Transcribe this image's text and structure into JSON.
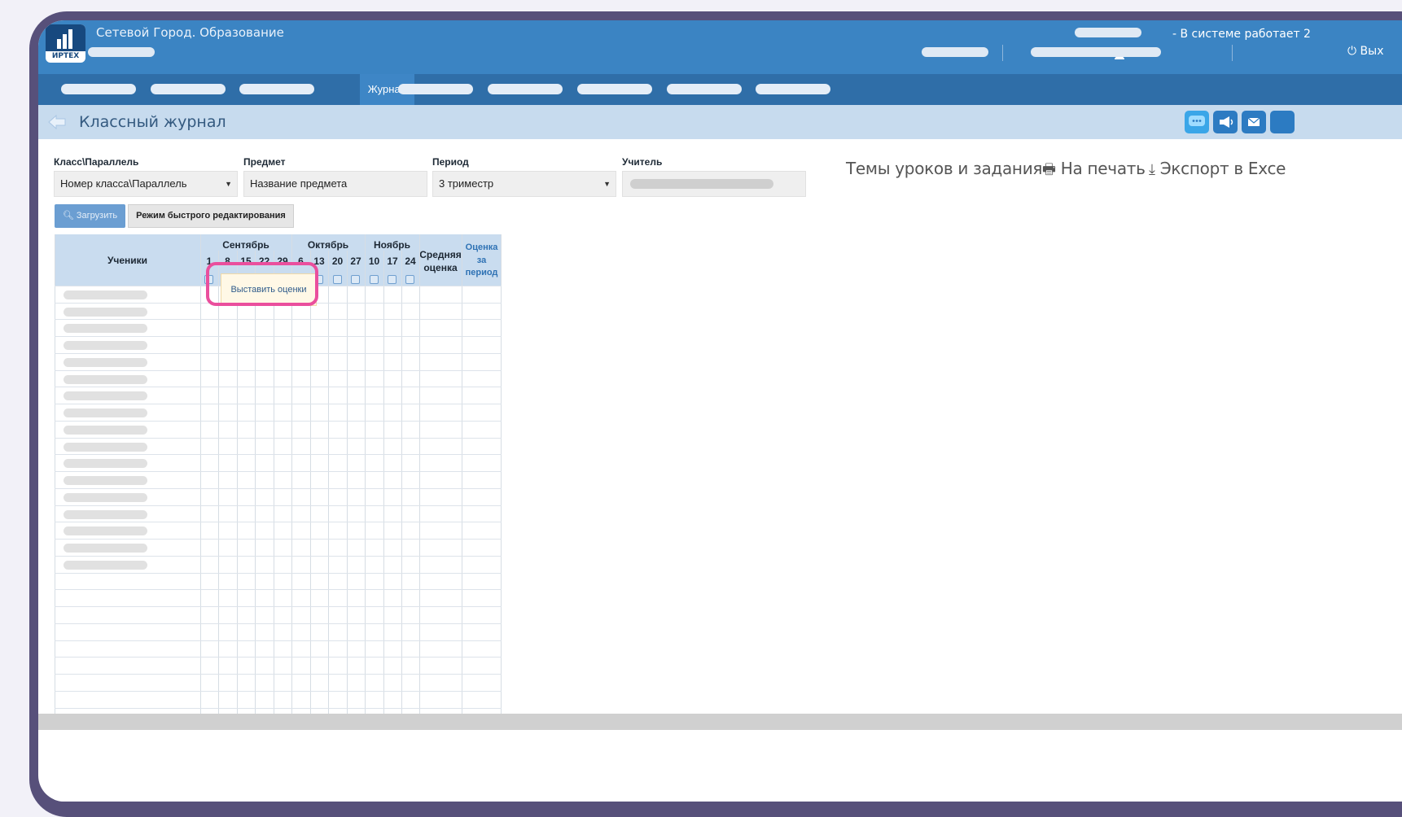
{
  "header": {
    "app_title": "Сетевой Город. Образование",
    "logo_text": "ИРТЕХ",
    "system_status": "- В системе работает 2",
    "logout_label": "Вых"
  },
  "nav": {
    "active_tab": "Журнал"
  },
  "page": {
    "title": "Классный журнал"
  },
  "filters": {
    "class_label": "Класс\\Параллель",
    "class_value": "Номер класса\\Параллель",
    "subject_label": "Предмет",
    "subject_value": "Название предмета",
    "period_label": "Период",
    "period_value": "3 триместр",
    "teacher_label": "Учитель"
  },
  "actions": {
    "topics_link": "Темы уроков и задания",
    "print_link": "На печать",
    "export_link": "Экспорт в Exce",
    "load_button": "Загрузить",
    "fast_edit_button": "Режим быстрого редактирования"
  },
  "journal": {
    "students_header": "Ученики",
    "months": [
      {
        "name": "Сентябрь",
        "days": [
          "1",
          "8",
          "15",
          "22",
          "29"
        ]
      },
      {
        "name": "Октябрь",
        "days": [
          "6",
          "13",
          "20",
          "27"
        ]
      },
      {
        "name": "Ноябрь",
        "days": [
          "10",
          "17",
          "24"
        ]
      }
    ],
    "avg_header_1": "Средняя",
    "avg_header_2": "оценка",
    "period_header_1": "Оценка",
    "period_header_2": "за",
    "period_header_3": "период",
    "tooltip": "Выставить оценки"
  },
  "colors": {
    "header_blue": "#3b84c3",
    "nav_blue": "#2f6ea8",
    "title_bar": "#c7dbee",
    "highlight_pink": "#ea4f9d"
  }
}
